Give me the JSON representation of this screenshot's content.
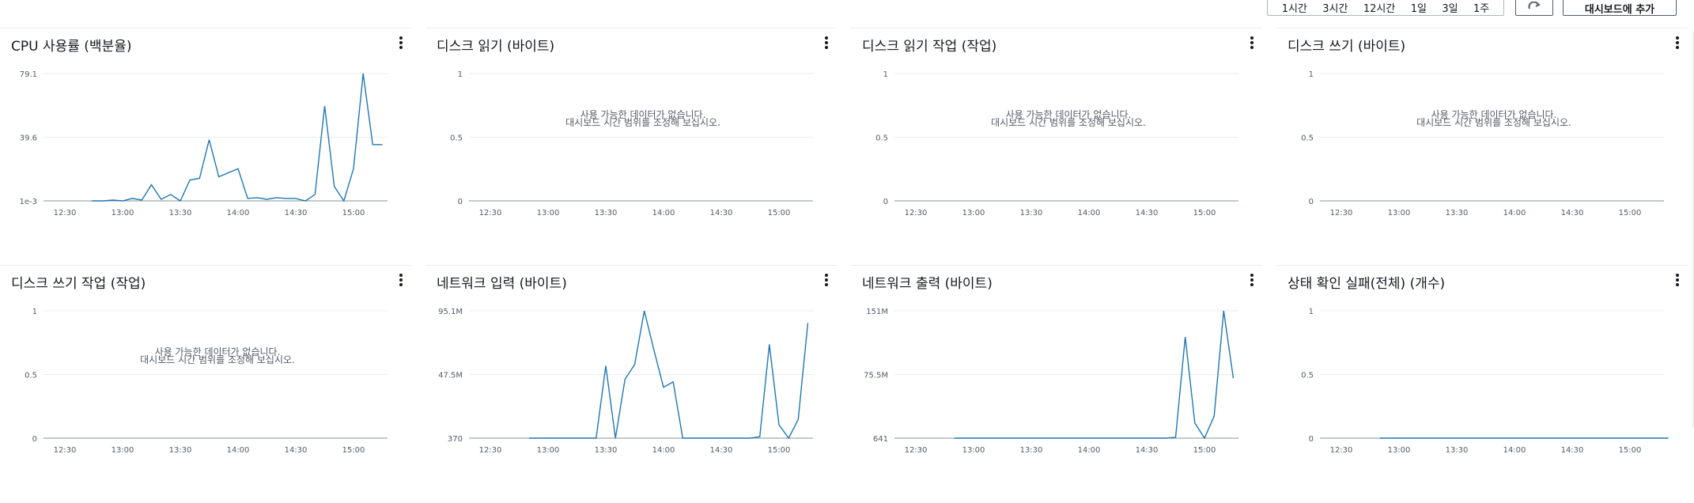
{
  "toolbar": {
    "ranges": [
      "1시간",
      "3시간",
      "12시간",
      "1일",
      "3일",
      "1주"
    ],
    "add_to_dashboard": "대시보드에 추가",
    "refresh_icon": "refresh-icon"
  },
  "nodata": {
    "line1": "사용 가능한 데이터가 없습니다.",
    "line2": "대시보드 시간 범위를 조정해 보십시오."
  },
  "x_ticks": [
    "12:30",
    "13:00",
    "13:30",
    "14:00",
    "14:30",
    "15:00"
  ],
  "colors": {
    "series": "#1f77b4",
    "grid": "#e9ebed",
    "axis": "#879596"
  },
  "panels": [
    {
      "title": "CPU 사용률 (백분율)",
      "chart_data": {
        "type": "line",
        "title": "CPU 사용률 (백분율)",
        "x": [
          "12:44",
          "12:50",
          "12:55",
          "13:00",
          "13:05",
          "13:10",
          "13:15",
          "13:20",
          "13:25",
          "13:30",
          "13:35",
          "13:40",
          "13:45",
          "13:50",
          "14:00",
          "14:05",
          "14:10",
          "14:15",
          "14:20",
          "14:25",
          "14:30",
          "14:35",
          "14:40",
          "14:45",
          "14:50",
          "14:55",
          "15:00",
          "15:05",
          "15:10",
          "15:15"
        ],
        "series": [
          {
            "values": [
              0.001,
              0.001,
              0.5,
              0.001,
              1.5,
              0.5,
              10,
              1,
              4,
              0.001,
              13,
              14,
              38,
              15,
              20,
              1.5,
              2,
              1,
              2,
              1.5,
              1.5,
              0.001,
              4,
              59,
              9,
              0.001,
              20,
              79.1,
              35,
              35
            ]
          }
        ],
        "y_ticks": [
          "79.1",
          "39.6",
          "1e-3"
        ],
        "ylim": [
          0.001,
          79.1
        ],
        "has_data": true
      }
    },
    {
      "title": "디스크 읽기 (바이트)",
      "chart_data": {
        "type": "line",
        "title": "디스크 읽기 (바이트)",
        "y_ticks": [
          "1",
          "0.5",
          "0"
        ],
        "ylim": [
          0,
          1
        ],
        "series": [],
        "has_data": false
      }
    },
    {
      "title": "디스크 읽기 작업 (작업)",
      "chart_data": {
        "type": "line",
        "title": "디스크 읽기 작업 (작업)",
        "y_ticks": [
          "1",
          "0.5",
          "0"
        ],
        "ylim": [
          0,
          1
        ],
        "series": [],
        "has_data": false
      }
    },
    {
      "title": "디스크 쓰기 (바이트)",
      "chart_data": {
        "type": "line",
        "title": "디스크 쓰기 (바이트)",
        "y_ticks": [
          "1",
          "0.5",
          "0"
        ],
        "ylim": [
          0,
          1
        ],
        "series": [],
        "has_data": false
      }
    },
    {
      "title": "디스크 쓰기 작업 (작업)",
      "chart_data": {
        "type": "line",
        "title": "디스크 쓰기 작업 (작업)",
        "y_ticks": [
          "1",
          "0.5",
          "0"
        ],
        "ylim": [
          0,
          1
        ],
        "series": [],
        "has_data": false
      }
    },
    {
      "title": "네트워크 입력 (바이트)",
      "chart_data": {
        "type": "line",
        "title": "네트워크 입력 (바이트)",
        "y_ticks": [
          "95.1M",
          "47.5M",
          "370"
        ],
        "ylim": [
          370,
          95100000
        ],
        "has_data": true,
        "x": [
          "12:50",
          "13:00",
          "13:10",
          "13:20",
          "13:25",
          "13:30",
          "13:35",
          "13:40",
          "13:45",
          "13:50",
          "13:55",
          "14:00",
          "14:05",
          "14:10",
          "14:20",
          "14:30",
          "14:40",
          "14:45",
          "14:50",
          "14:55",
          "15:00",
          "15:05",
          "15:10",
          "15:15"
        ],
        "series": [
          {
            "values": [
              370,
              370,
              370,
              370,
              370,
              54000000,
              370,
              44000000,
              55000000,
              95100000,
              66000000,
              38000000,
              42000000,
              370,
              370,
              370,
              370,
              370,
              1000000,
              70000000,
              10000000,
              370,
              14000000,
              86000000
            ]
          }
        ]
      }
    },
    {
      "title": "네트워크 출력 (바이트)",
      "chart_data": {
        "type": "line",
        "title": "네트워크 출력 (바이트)",
        "y_ticks": [
          "151M",
          "75.5M",
          "641"
        ],
        "ylim": [
          641,
          151000000
        ],
        "has_data": true,
        "x": [
          "12:50",
          "13:00",
          "13:10",
          "13:20",
          "13:30",
          "13:40",
          "13:50",
          "14:00",
          "14:10",
          "14:20",
          "14:30",
          "14:40",
          "14:45",
          "14:50",
          "14:55",
          "15:00",
          "15:05",
          "15:10",
          "15:15"
        ],
        "series": [
          {
            "values": [
              641,
              641,
              641,
              641,
              641,
              641,
              641,
              641,
              641,
              641,
              641,
              641,
              1000000,
              120000000,
              18000000,
              641,
              26000000,
              151000000,
              71000000
            ]
          }
        ]
      }
    },
    {
      "title": "상태 확인 실패(전체) (개수)",
      "chart_data": {
        "type": "line",
        "title": "상태 확인 실패(전체) (개수)",
        "y_ticks": [
          "1",
          "0.5",
          "0"
        ],
        "ylim": [
          0,
          1
        ],
        "has_data": true,
        "x": [
          "12:50",
          "13:00",
          "13:10",
          "13:20",
          "13:30",
          "13:40",
          "13:50",
          "14:00",
          "14:10",
          "14:20",
          "14:30",
          "14:40",
          "14:50",
          "15:00",
          "15:10",
          "15:20"
        ],
        "series": [
          {
            "values": [
              0,
              0,
              0,
              0,
              0,
              0,
              0,
              0,
              0,
              0,
              0,
              0,
              0,
              0,
              0,
              0
            ]
          }
        ]
      }
    }
  ]
}
